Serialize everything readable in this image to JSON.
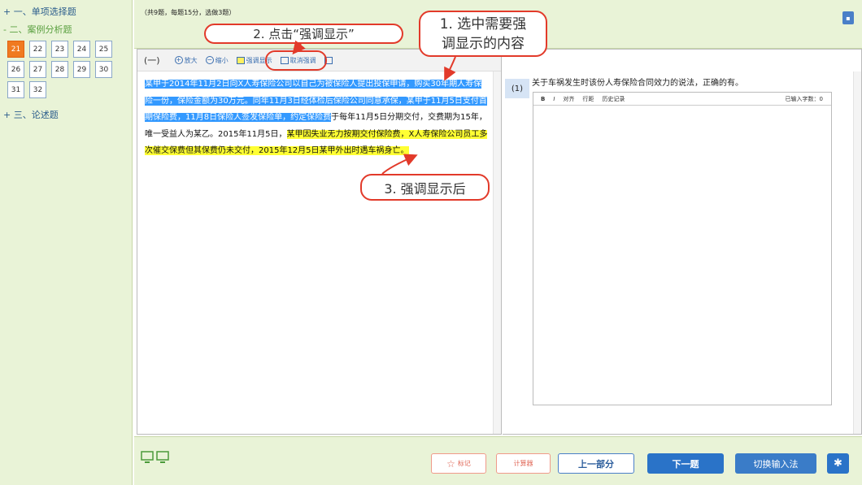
{
  "sidebar": {
    "sections": [
      {
        "label": "+ 一、单项选择题",
        "active": false
      },
      {
        "label": "- 二、案例分析题",
        "active": true
      },
      {
        "label": "+ 三、论述题",
        "active": false
      }
    ],
    "question_numbers": [
      "21",
      "22",
      "23",
      "24",
      "25",
      "26",
      "27",
      "28",
      "29",
      "30",
      "31",
      "32"
    ],
    "current_question": "21"
  },
  "topbar": {
    "info": "（共9题，每题15分，选做3题）",
    "corner_icon": "collapse-icon"
  },
  "left_pane": {
    "roman": "(一)",
    "toolbar": {
      "zoom_in": "放大",
      "zoom_out": "缩小",
      "highlight": "强调显示",
      "cancel_highlight": "取消强调"
    },
    "passage": {
      "blue_1": "某甲于2014年11月2日向X人寿保险公司以自己为被保险人提出投保申请，购买30年期人寿保险一份，保险金额为30万元。同年11月3日经体检后保险公司同意承保，某甲于11月5日支付首期保险费，11月8日保险人签发保险单，约定保险费",
      "plain": "于每年11月5日分期交付，交费期为15年，唯一受益人为某乙。2015年11月5日，",
      "yellow": "某甲因失业无力按期交付保险费，X人寿保险公司员工多次催交保费但其保费仍未交付，2015年12月5日某甲外出时遇车祸身亡。"
    }
  },
  "right_pane": {
    "question_number": "(1)",
    "question_text": "关于车祸发生时该份人寿保险合同效力的说法，正确的有。",
    "editor": {
      "tools": [
        "B",
        "I",
        "对齐",
        "行距",
        "历史记录"
      ],
      "char_count": "已输入字数：0"
    }
  },
  "bottombar": {
    "mark": "标记",
    "calculator": "计算器",
    "prev_part": "上一部分",
    "next_question": "下一题",
    "switch_input": "切换输入法"
  },
  "callouts": {
    "step1_line1": "1. 选中需要强",
    "step1_line2": "调显示的内容",
    "step2": "2. 点击“强调显示”",
    "step3": "3. 强调显示后"
  },
  "colors": {
    "sidebar_bg": "#e9f3d7",
    "accent_blue": "#2a73c8",
    "current_orange": "#f07a20",
    "highlight_blue": "#3399ff",
    "highlight_yellow": "#ffff33",
    "callout_red": "#e23a2a"
  }
}
